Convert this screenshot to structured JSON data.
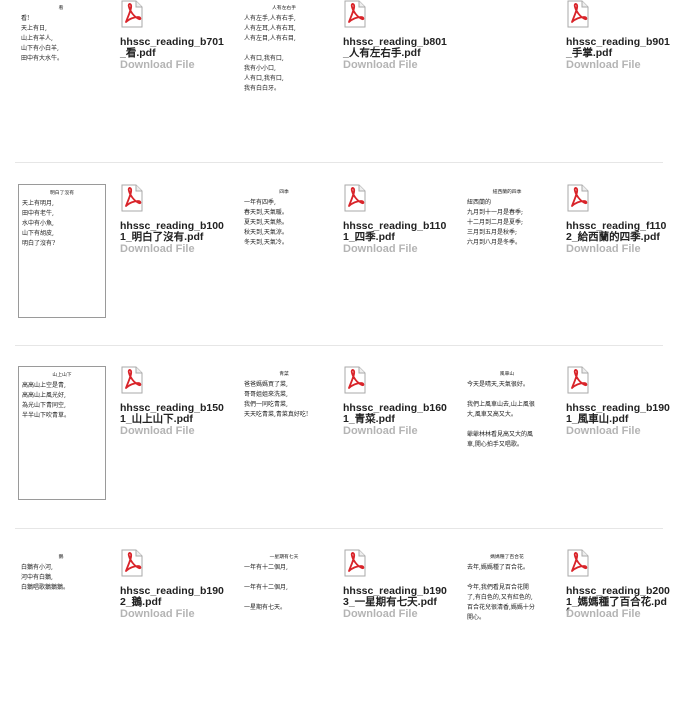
{
  "download_label": "Download File",
  "files": [
    {
      "name": "hhssc_reading_b701_看.pdf",
      "thumb": {
        "title": "看",
        "lines": [
          "看!",
          "天上有日,",
          "山上有羊人,",
          "山下有小白羊,",
          "田中有大水牛。"
        ]
      }
    },
    {
      "name": "hhssc_reading_b801_人有左右手.pdf",
      "thumb": {
        "title": "人有左右手",
        "lines": [
          "人有左手,人有右手,",
          "人有左耳,人有右耳,",
          "人有左目,人有右目,",
          "",
          "人有口,我有口,",
          "我有小小口,",
          "人有口,我有口,",
          "我有白白牙。"
        ]
      }
    },
    {
      "name": "hhssc_reading_b901_手掌.pdf",
      "thumb": null
    },
    {
      "name": "hhssc_reading_b1001_明白了沒有.pdf",
      "thumb": {
        "title": "明白了沒有",
        "lines": [
          "天上有明月,",
          "田中有老牛,",
          "水中有小魚,",
          "山下有胡皮,",
          "明白了沒有?"
        ]
      }
    },
    {
      "name": "hhssc_reading_b1101_四季.pdf",
      "thumb": {
        "title": "四季",
        "lines": [
          "一年有四季,",
          "春天到,天氣暖。",
          "夏天到,天氣熱。",
          "秋天到,天氣涼。",
          "冬天到,天氣冷。"
        ]
      }
    },
    {
      "name": "hhssc_reading_f1102_給西蘭的四季.pdf",
      "thumb": {
        "title": "紐西蘭的四季",
        "lines": [
          "紐西蘭的",
          "九月到十一月是春季;",
          "十二月到二月是夏季;",
          "三月到五月是秋季;",
          "六月到八月是冬季。"
        ]
      }
    },
    {
      "name": "hhssc_reading_b1501_山上山下.pdf",
      "thumb": {
        "title": "山上山下",
        "lines": [
          "高高山上空是青,",
          "高高山上風光好,",
          "為光山下青同空,",
          "半半山下吹青草。"
        ]
      }
    },
    {
      "name": "hhssc_reading_b1601_青菜.pdf",
      "thumb": {
        "title": "青菜",
        "lines": [
          "爸爸媽媽買了菜,",
          "哥哥姐姐來洗菜,",
          "我們一同吃青菜,",
          "天天吃青菜,青菜真好吃!"
        ]
      }
    },
    {
      "name": "hhssc_reading_b1901_風車山.pdf",
      "thumb": {
        "title": "風車山",
        "lines": [
          "今天是晴天,天氣很好。",
          "",
          "我們上風車山去,山上風很",
          "大,風車又高又大。",
          "",
          "爺爺林林看見高又大的風",
          "車,開心拍手又唱歌。"
        ]
      }
    },
    {
      "name": "hhssc_reading_b1902_鵝.pdf",
      "thumb": {
        "title": "鵝",
        "lines": [
          "白鵝有小河,",
          "河中有白鵝,",
          "白鵝唱歌鵝鵝鵝。"
        ]
      }
    },
    {
      "name": "hhssc_reading_b1903_一星期有七天.pdf",
      "thumb": {
        "title": "一星期有七天",
        "lines": [
          "一年有十二個月,",
          "",
          "一年有十二個月,",
          "",
          "一星期有七天。"
        ]
      }
    },
    {
      "name": "hhssc_reading_b2001_媽媽種了百合花.pdf",
      "thumb": {
        "title": "媽媽種了百合花",
        "lines": [
          "去年,媽媽種了百合花。",
          "",
          "今年,我們看見百合花開",
          "了,有白色的,又有紅色的,",
          "百合花兒很清香,媽媽十分",
          "開心。"
        ]
      }
    }
  ],
  "colors": {
    "pdf_red": "#d9242a",
    "download_gray": "#b4b4b4",
    "separator": "#e6e6e6"
  }
}
